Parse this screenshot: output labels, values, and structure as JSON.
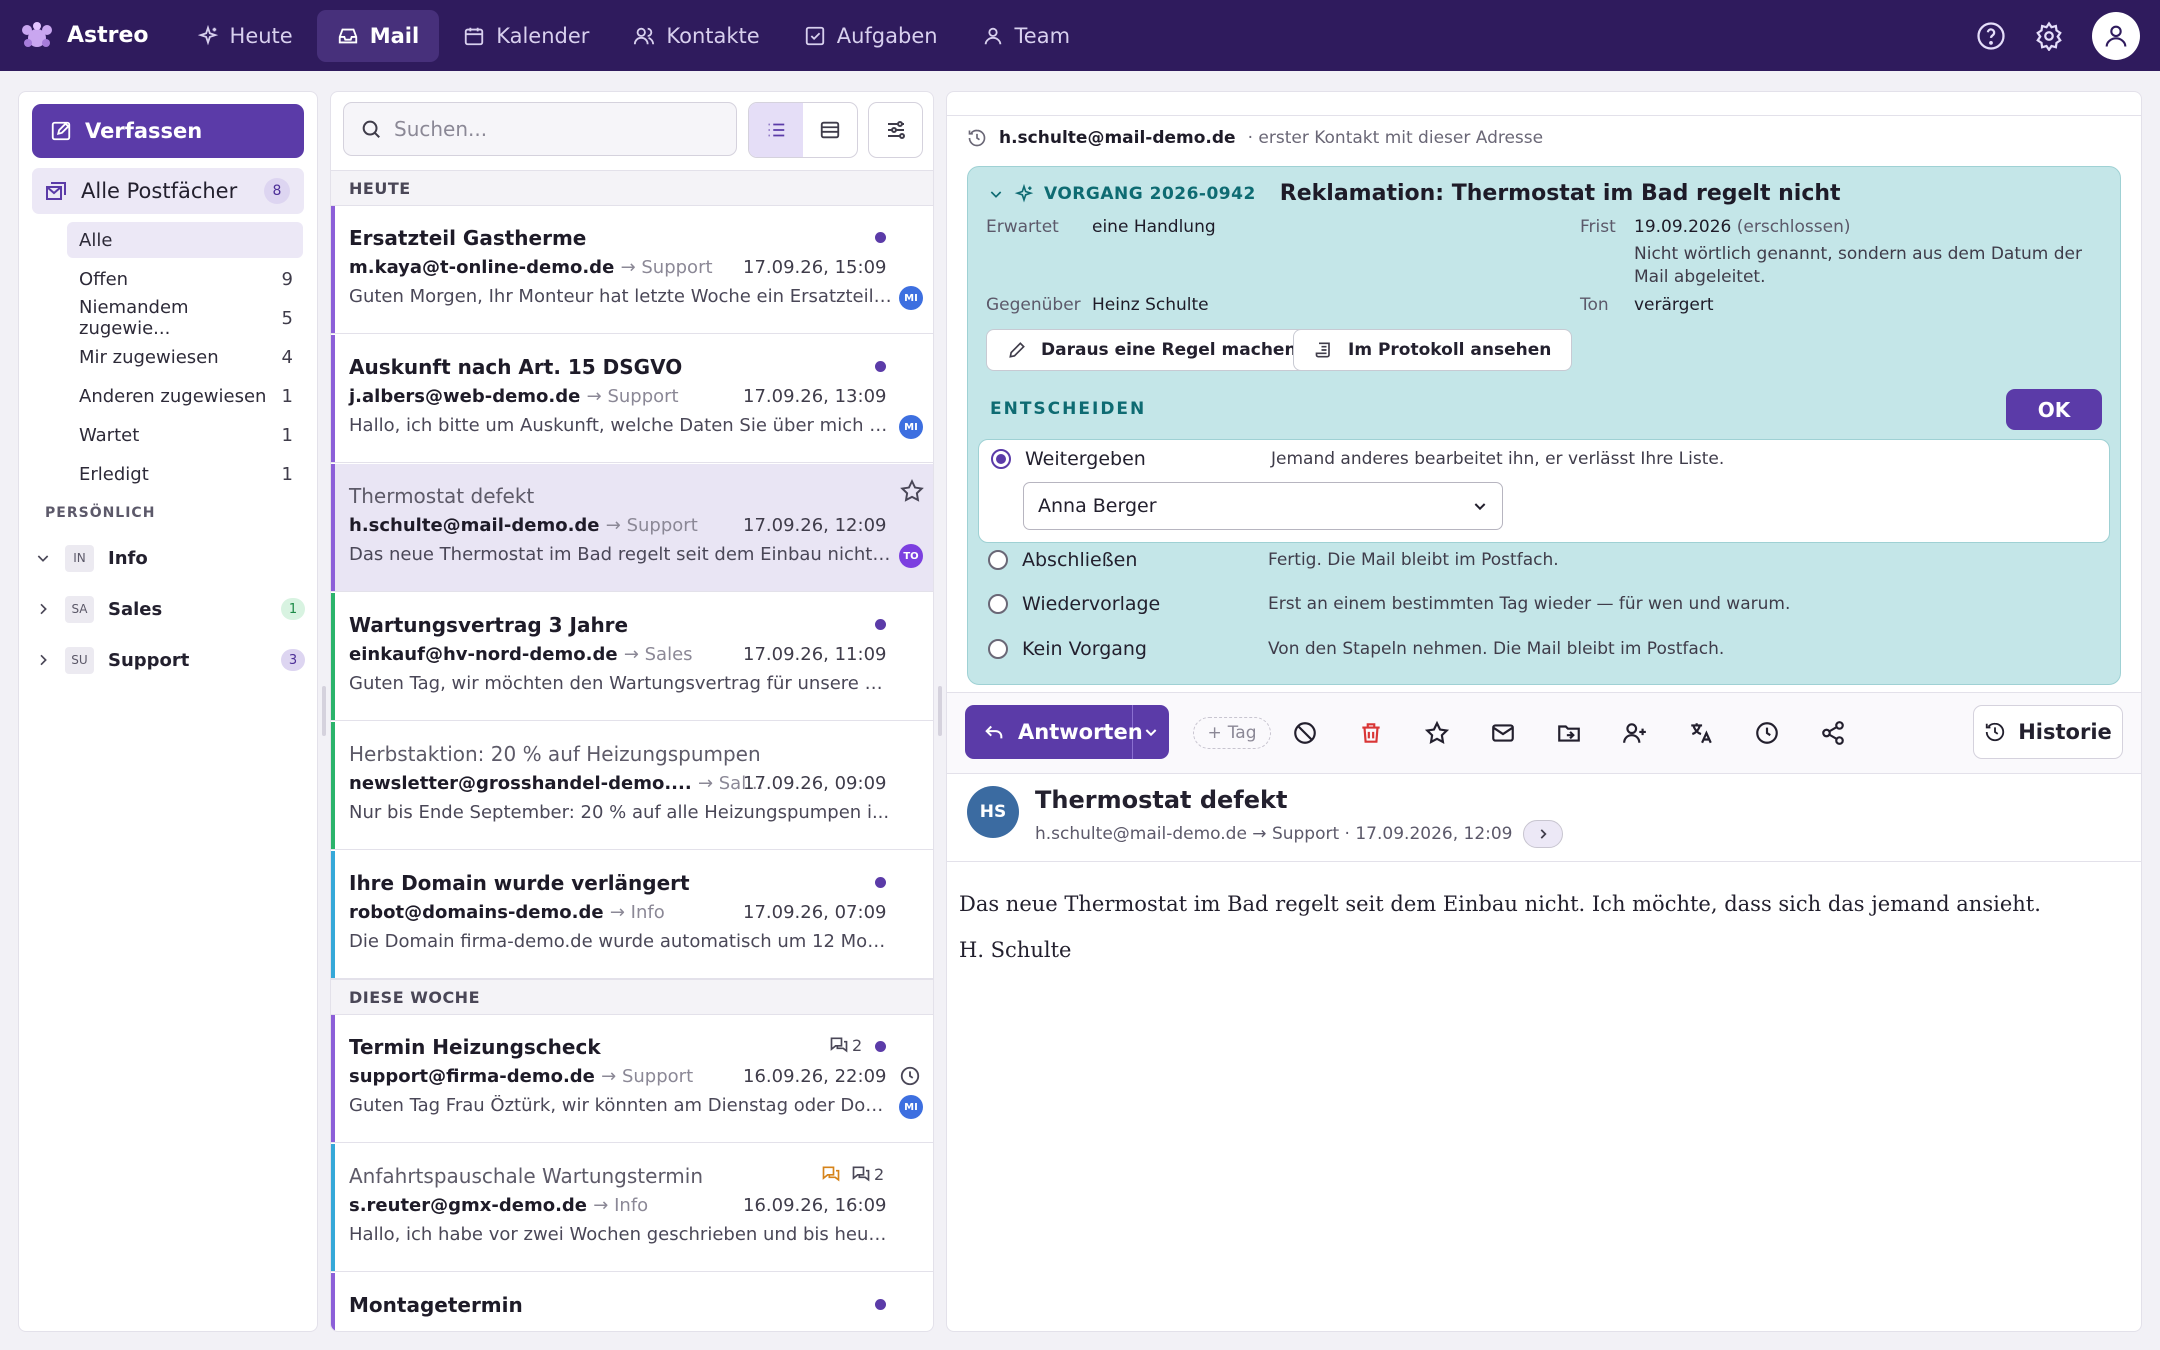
{
  "app": {
    "name": "Astreo"
  },
  "nav": [
    {
      "label": "Heute",
      "icon": "sparkle-icon"
    },
    {
      "label": "Mail",
      "icon": "inbox-icon",
      "active": true
    },
    {
      "label": "Kalender",
      "icon": "calendar-icon"
    },
    {
      "label": "Kontakte",
      "icon": "contacts-icon"
    },
    {
      "label": "Aufgaben",
      "icon": "task-icon"
    },
    {
      "label": "Team",
      "icon": "team-icon"
    }
  ],
  "sidebar": {
    "compose": "Verfassen",
    "all_mailboxes": {
      "label": "Alle Postfächer",
      "count": "8"
    },
    "filters": [
      {
        "label": "Alle",
        "count": ""
      },
      {
        "label": "Offen",
        "count": "9"
      },
      {
        "label": "Niemandem zugewie...",
        "count": "5"
      },
      {
        "label": "Mir zugewiesen",
        "count": "4"
      },
      {
        "label": "Anderen zugewiesen",
        "count": "1"
      },
      {
        "label": "Wartet",
        "count": "1"
      },
      {
        "label": "Erledigt",
        "count": "1"
      }
    ],
    "section": "PERSÖNLICH",
    "folders": [
      {
        "tag": "IN",
        "label": "Info",
        "count": ""
      },
      {
        "tag": "SA",
        "label": "Sales",
        "count": "1"
      },
      {
        "tag": "SU",
        "label": "Support",
        "count": "3"
      }
    ]
  },
  "maillist": {
    "search_placeholder": "Suchen...",
    "group_today": "HEUTE",
    "group_week": "DIESE WOCHE",
    "items": [
      {
        "subject": "Ersatzteil Gastherme",
        "from": "m.kaya@t-online-demo.de",
        "box": "→ Support",
        "date": "17.09.26, 15:09",
        "preview": "Guten Morgen, Ihr Monteur hat letzte Woche ein Ersatzteil f...",
        "badge": "MI"
      },
      {
        "subject": "Auskunft nach Art. 15 DSGVO",
        "from": "j.albers@web-demo.de",
        "box": "→ Support",
        "date": "17.09.26, 13:09",
        "preview": "Hallo, ich bitte um Auskunft, welche Daten Sie über mich g...",
        "badge": "MI"
      },
      {
        "subject": "Thermostat defekt",
        "from": "h.schulte@mail-demo.de",
        "box": "→ Support",
        "date": "17.09.26, 12:09",
        "preview": "Das neue Thermostat im Bad regelt seit dem Einbau nicht. I...",
        "badge": "TO"
      },
      {
        "subject": "Wartungsvertrag 3 Jahre",
        "from": "einkauf@hv-nord-demo.de",
        "box": "→ Sales",
        "date": "17.09.26, 11:09",
        "preview": "Guten Tag, wir möchten den Wartungsvertrag für unsere 14..."
      },
      {
        "subject": "Herbstaktion: 20 % auf Heizungspumpen",
        "from": "newsletter@grosshandel-demo....",
        "box": "→ Sal...",
        "date": "17.09.26, 09:09",
        "preview": "Nur bis Ende September: 20 % auf alle Heizungspumpen i..."
      },
      {
        "subject": "Ihre Domain wurde verlängert",
        "from": "robot@domains-demo.de",
        "box": "→ Info",
        "date": "17.09.26, 07:09",
        "preview": "Die Domain firma-demo.de wurde automatisch um 12 Mon..."
      },
      {
        "subject": "Termin Heizungscheck",
        "from": "support@firma-demo.de",
        "box": "→ Support",
        "date": "16.09.26, 22:09",
        "preview": "Guten Tag Frau Öztürk, wir könnten am Dienstag oder Donn...",
        "badge": "MI",
        "thread": "2"
      },
      {
        "subject": "Anfahrtspauschale Wartungstermin",
        "from": "s.reuter@gmx-demo.de",
        "box": "→ Info",
        "date": "16.09.26, 16:09",
        "preview": "Hallo, ich habe vor zwei Wochen geschrieben und bis heute...",
        "thread": "2"
      },
      {
        "subject": "Montagetermin"
      }
    ]
  },
  "detail": {
    "sender": "h.schulte@mail-demo.de",
    "sender_note": "· erster Kontakt mit dieser Adresse",
    "vorgang": {
      "id": "VORGANG 2026-0942",
      "title": "Reklamation: Thermostat im Bad regelt nicht",
      "expected_label": "Erwartet",
      "expected": "eine Handlung",
      "due_label": "Frist",
      "due": "19.09.2026",
      "due_note": "(erschlossen)",
      "note": "Nicht wörtlich genannt, sondern aus dem Datum der Mail abgeleitet.",
      "counterpart_label": "Gegenüber",
      "counterpart": "Heinz Schulte",
      "tone_label": "Ton",
      "tone": "verärgert",
      "rule_btn": "Daraus eine Regel machen",
      "log_btn": "Im Protokoll ansehen",
      "decide": "ENTSCHEIDEN",
      "ok": "OK",
      "options": [
        {
          "label": "Weitergeben",
          "desc": "Jemand anderes bearbeitet ihn, er verlässt Ihre Liste.",
          "selected": true
        },
        {
          "label": "Abschließen",
          "desc": "Fertig. Die Mail bleibt im Postfach."
        },
        {
          "label": "Wiedervorlage",
          "desc": "Erst an einem bestimmten Tag wieder — für wen und warum."
        },
        {
          "label": "Kein Vorgang",
          "desc": "Von den Stapeln nehmen. Die Mail bleibt im Postfach."
        }
      ],
      "assignee": "Anna Berger"
    },
    "toolbar": {
      "reply": "Antworten",
      "tag": "Tag",
      "history": "Historie"
    },
    "message": {
      "initials": "HS",
      "subject": "Thermostat defekt",
      "meta": "h.schulte@mail-demo.de → Support · 17.09.2026, 12:09",
      "body": [
        "Das neue Thermostat im Bad regelt seit dem Einbau nicht. Ich möchte, dass sich das jemand ansieht.",
        "H. Schulte"
      ]
    }
  },
  "colors": {
    "topbar": "#2f1b5d",
    "accent": "#5b3ba8",
    "vorgang_bg": "#c4e6e8"
  }
}
